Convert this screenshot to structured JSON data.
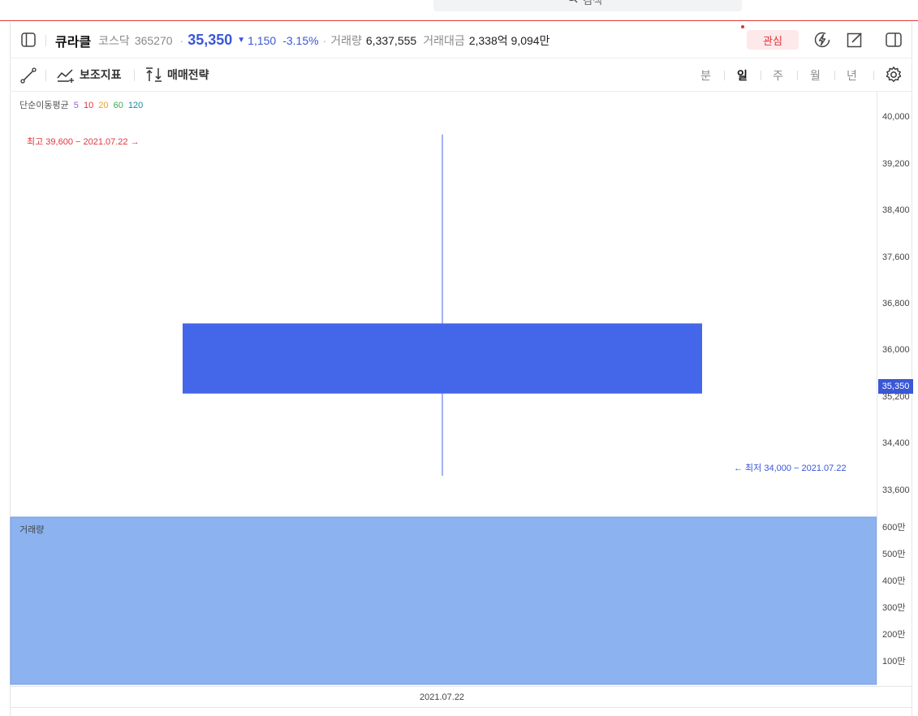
{
  "search": {
    "text": "검색"
  },
  "header": {
    "stock_name": "큐라클",
    "market": "코스닥",
    "code": "365270",
    "price": "35,350",
    "change": "1,150",
    "change_pct": "-3.15%",
    "volume_label": "거래량",
    "volume_value": "6,337,555",
    "amount_label": "거래대금",
    "amount_value": "2,338억 9,094만",
    "watch_label": "관심"
  },
  "toolbar": {
    "indicator_label": "보조지표",
    "strategy_label": "매매전략",
    "periods": [
      "분",
      "일",
      "주",
      "월",
      "년"
    ],
    "active_period": "일"
  },
  "colors": {
    "down": "#3a57d6",
    "up": "#e0363b",
    "candle": "#4466e8",
    "volume": "#8cb2f0"
  },
  "ma_legend": {
    "label": "단순이동평균",
    "periods": [
      {
        "value": "5",
        "color": "#a05ad8"
      },
      {
        "value": "10",
        "color": "#e0363b"
      },
      {
        "value": "20",
        "color": "#f0a020"
      },
      {
        "value": "60",
        "color": "#3aaa55"
      },
      {
        "value": "120",
        "color": "#1a8a9a"
      }
    ]
  },
  "annotations": {
    "high": "최고 39,600 − 2021.07.22 →",
    "low": "← 최저 34,000 − 2021.07.22"
  },
  "price_axis": [
    "40,000",
    "39,200",
    "38,400",
    "37,600",
    "36,800",
    "36,000",
    "35,200",
    "34,400",
    "33,600"
  ],
  "current_price_tag": "35,350",
  "volume_panel": {
    "label": "거래량",
    "axis": [
      "600만",
      "500만",
      "400만",
      "300만",
      "200만",
      "100만"
    ]
  },
  "chart_data": {
    "type": "candlestick",
    "x": [
      "2021.07.22"
    ],
    "open": [
      36500
    ],
    "high": [
      39600
    ],
    "low": [
      34000
    ],
    "close": [
      35350
    ],
    "volume": [
      6337555
    ],
    "ylim": [
      33350,
      40300
    ],
    "volume_ylim": [
      0,
      6300000
    ]
  }
}
